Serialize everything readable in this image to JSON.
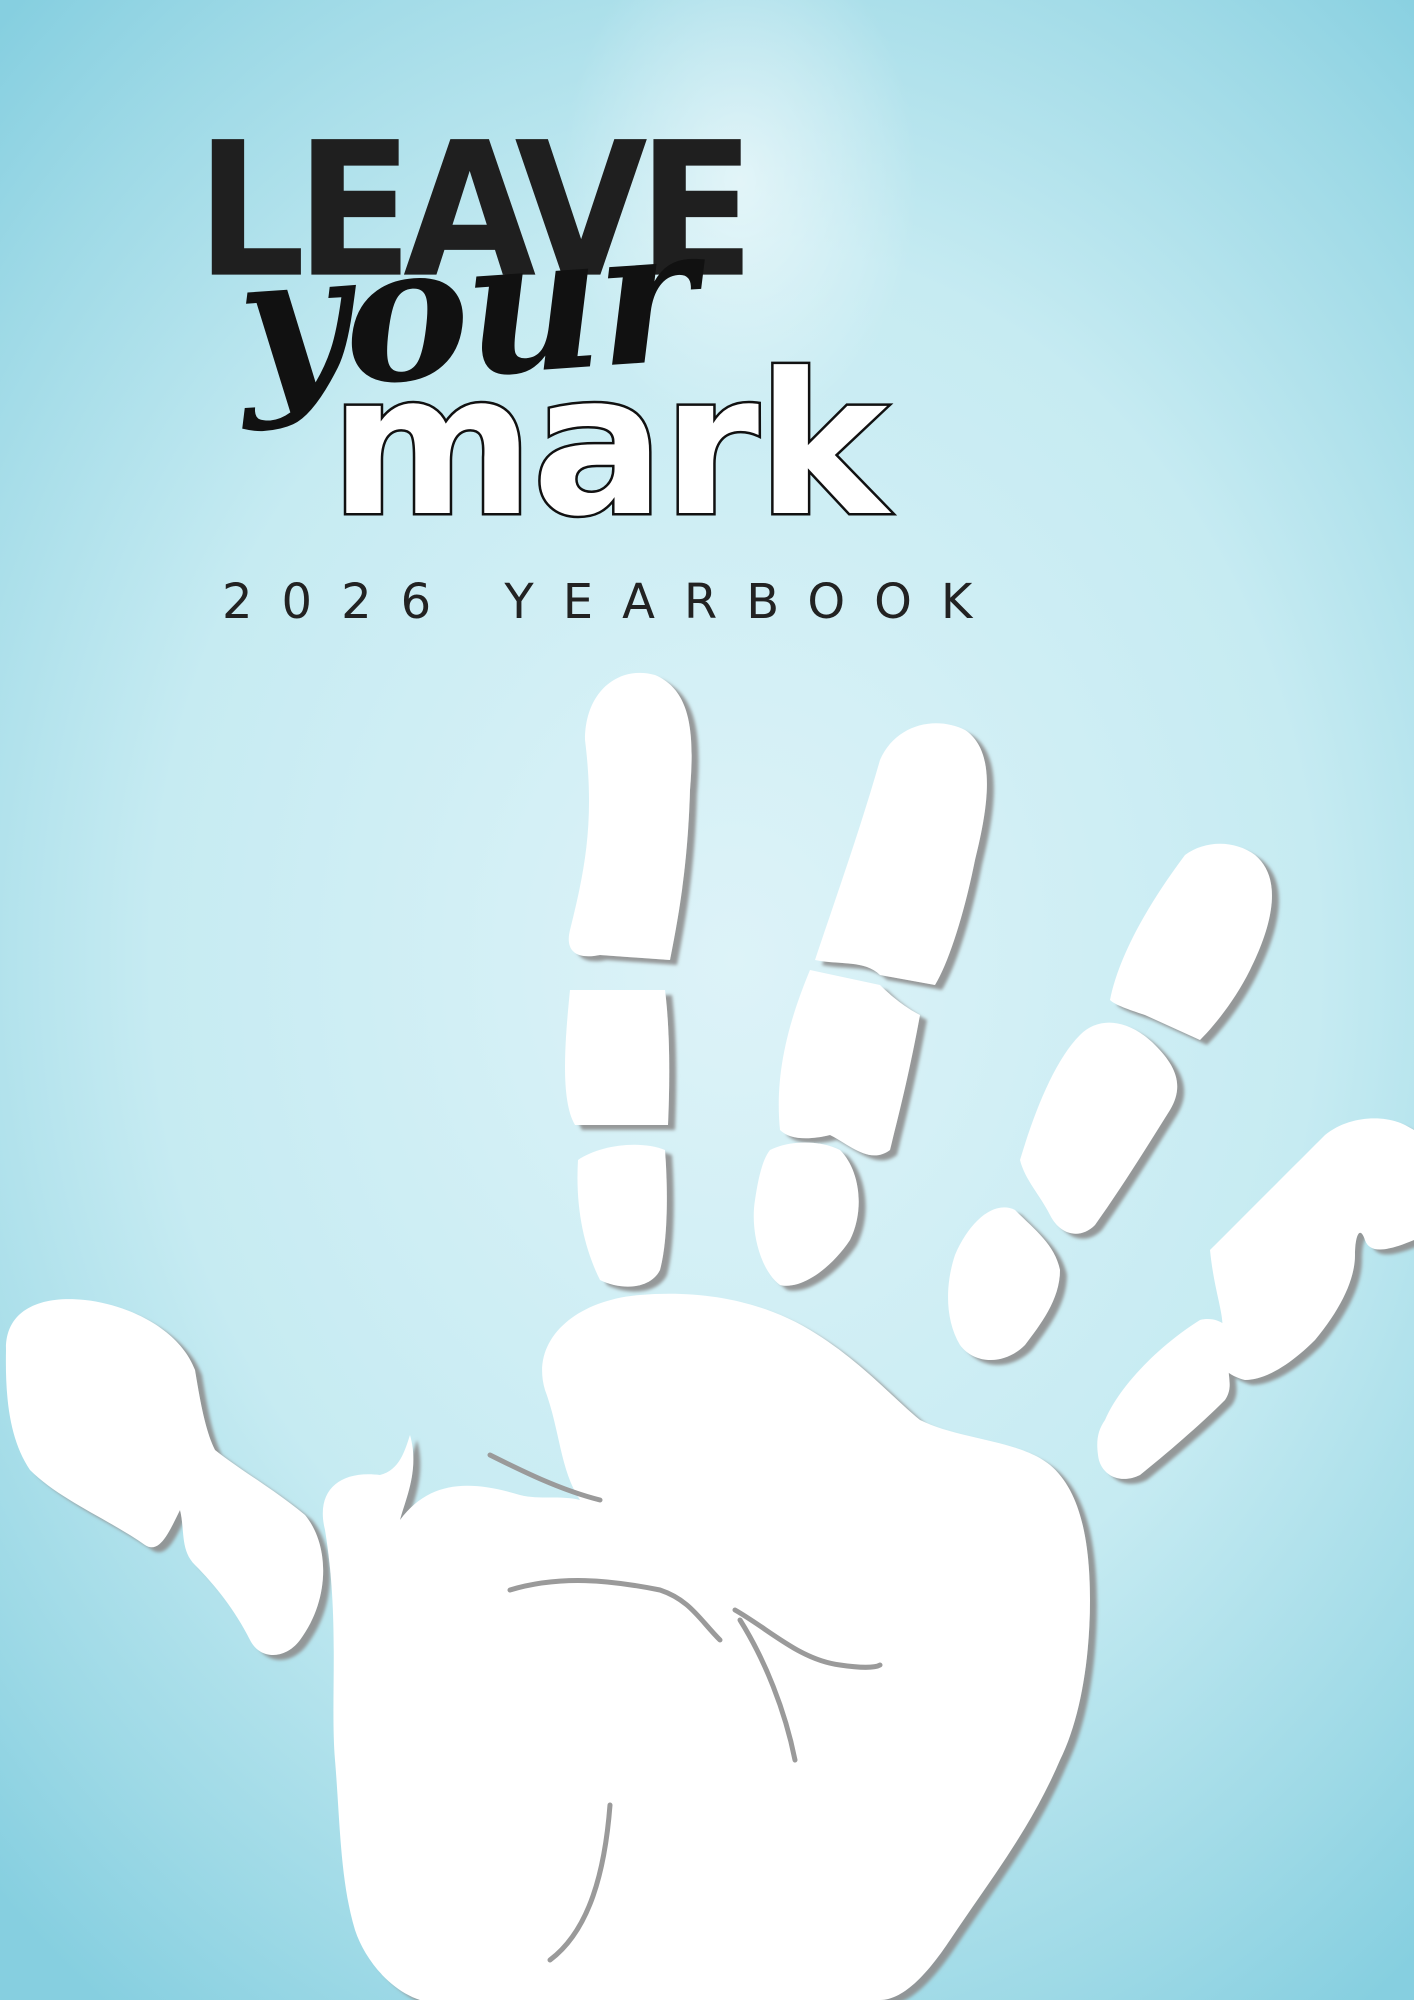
{
  "cover": {
    "title_line1": "LEAVE",
    "title_line2": "your",
    "title_line3": "mark",
    "subtitle": "2026 YEARBOOK"
  },
  "colors": {
    "background": "#c6ebf2",
    "background_edge": "#86cfe0",
    "title": "#1f1f1f",
    "handprint": "#ffffff",
    "handprint_shadow": "#999999"
  },
  "illustration": {
    "icon": "handprint-icon"
  }
}
